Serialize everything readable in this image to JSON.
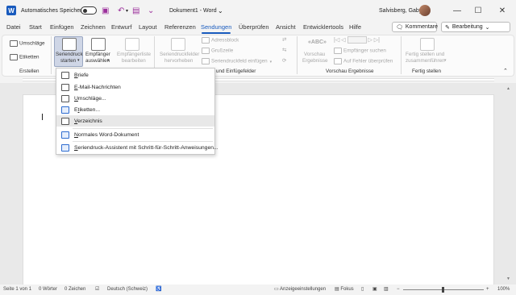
{
  "titlebar": {
    "autosave_label": "Automatisches Speichern",
    "autosave_state": "Aus",
    "doc_title": "Dokument1",
    "app_name": "Word",
    "user_name": "Salvisberg, Gaby"
  },
  "menu": {
    "tabs": [
      "Datei",
      "Start",
      "Einfügen",
      "Zeichnen",
      "Entwurf",
      "Layout",
      "Referenzen",
      "Sendungen",
      "Überprüfen",
      "Ansicht",
      "Entwicklertools",
      "Hilfe"
    ],
    "active_tab": "Sendungen",
    "comments_label": "Kommentare",
    "editing_label": "Bearbeitung"
  },
  "ribbon": {
    "erstellen": {
      "label": "Erstellen",
      "umschlaege": "Umschläge",
      "etiketten": "Etiketten"
    },
    "seriendruck": {
      "start_line1": "Seriendruck",
      "start_line2": "starten",
      "empfaenger_line1": "Empfänger",
      "empfaenger_line2": "auswählen",
      "liste_line1": "Empfängerliste",
      "liste_line2": "bearbeiten"
    },
    "felder": {
      "label": "Felder schreiben und einfügen",
      "label_visible": "und Einfügefelder",
      "hervorheben_line1": "Seriendruckfelder",
      "hervorheben_line2": "hervorheben",
      "adressblock": "Adressblock",
      "grusszeile": "Grußzeile",
      "feld_einfuegen": "Seriendruckfeld einfügen"
    },
    "vorschau": {
      "label": "Vorschau Ergebnisse",
      "vorschau_line1": "Vorschau",
      "vorschau_line2": "Ergebnisse",
      "empfaenger_suchen": "Empfänger suchen",
      "fehler_pruefen": "Auf Fehler überprüfen"
    },
    "fertigstellen": {
      "label": "Fertig stellen",
      "btn_line1": "Fertig stellen und",
      "btn_line2": "zusammenführen"
    }
  },
  "dropdown": {
    "items": [
      {
        "label": "Briefe",
        "accel": "B"
      },
      {
        "label": "E-Mail-Nachrichten",
        "accel": "E"
      },
      {
        "label": "Umschläge...",
        "accel": "U"
      },
      {
        "label": "Etiketten...",
        "accel": "t"
      },
      {
        "label": "Verzeichnis",
        "accel": "V"
      },
      {
        "label": "Normales Word-Dokument",
        "accel": "N"
      },
      {
        "label": "Seriendruck-Assistent mit Schritt-für-Schritt-Anweisungen...",
        "accel": "S"
      }
    ],
    "hover_index": 4
  },
  "status": {
    "page": "Seite 1 von 1",
    "words": "0 Wörter",
    "chars": "0 Zeichen",
    "language": "Deutsch (Schweiz)",
    "display_settings": "Anzeigeeinstellungen",
    "focus": "Fokus",
    "zoom": "100%"
  },
  "colors": {
    "accent": "#185abd",
    "brand_purple": "#9b2f9b"
  }
}
